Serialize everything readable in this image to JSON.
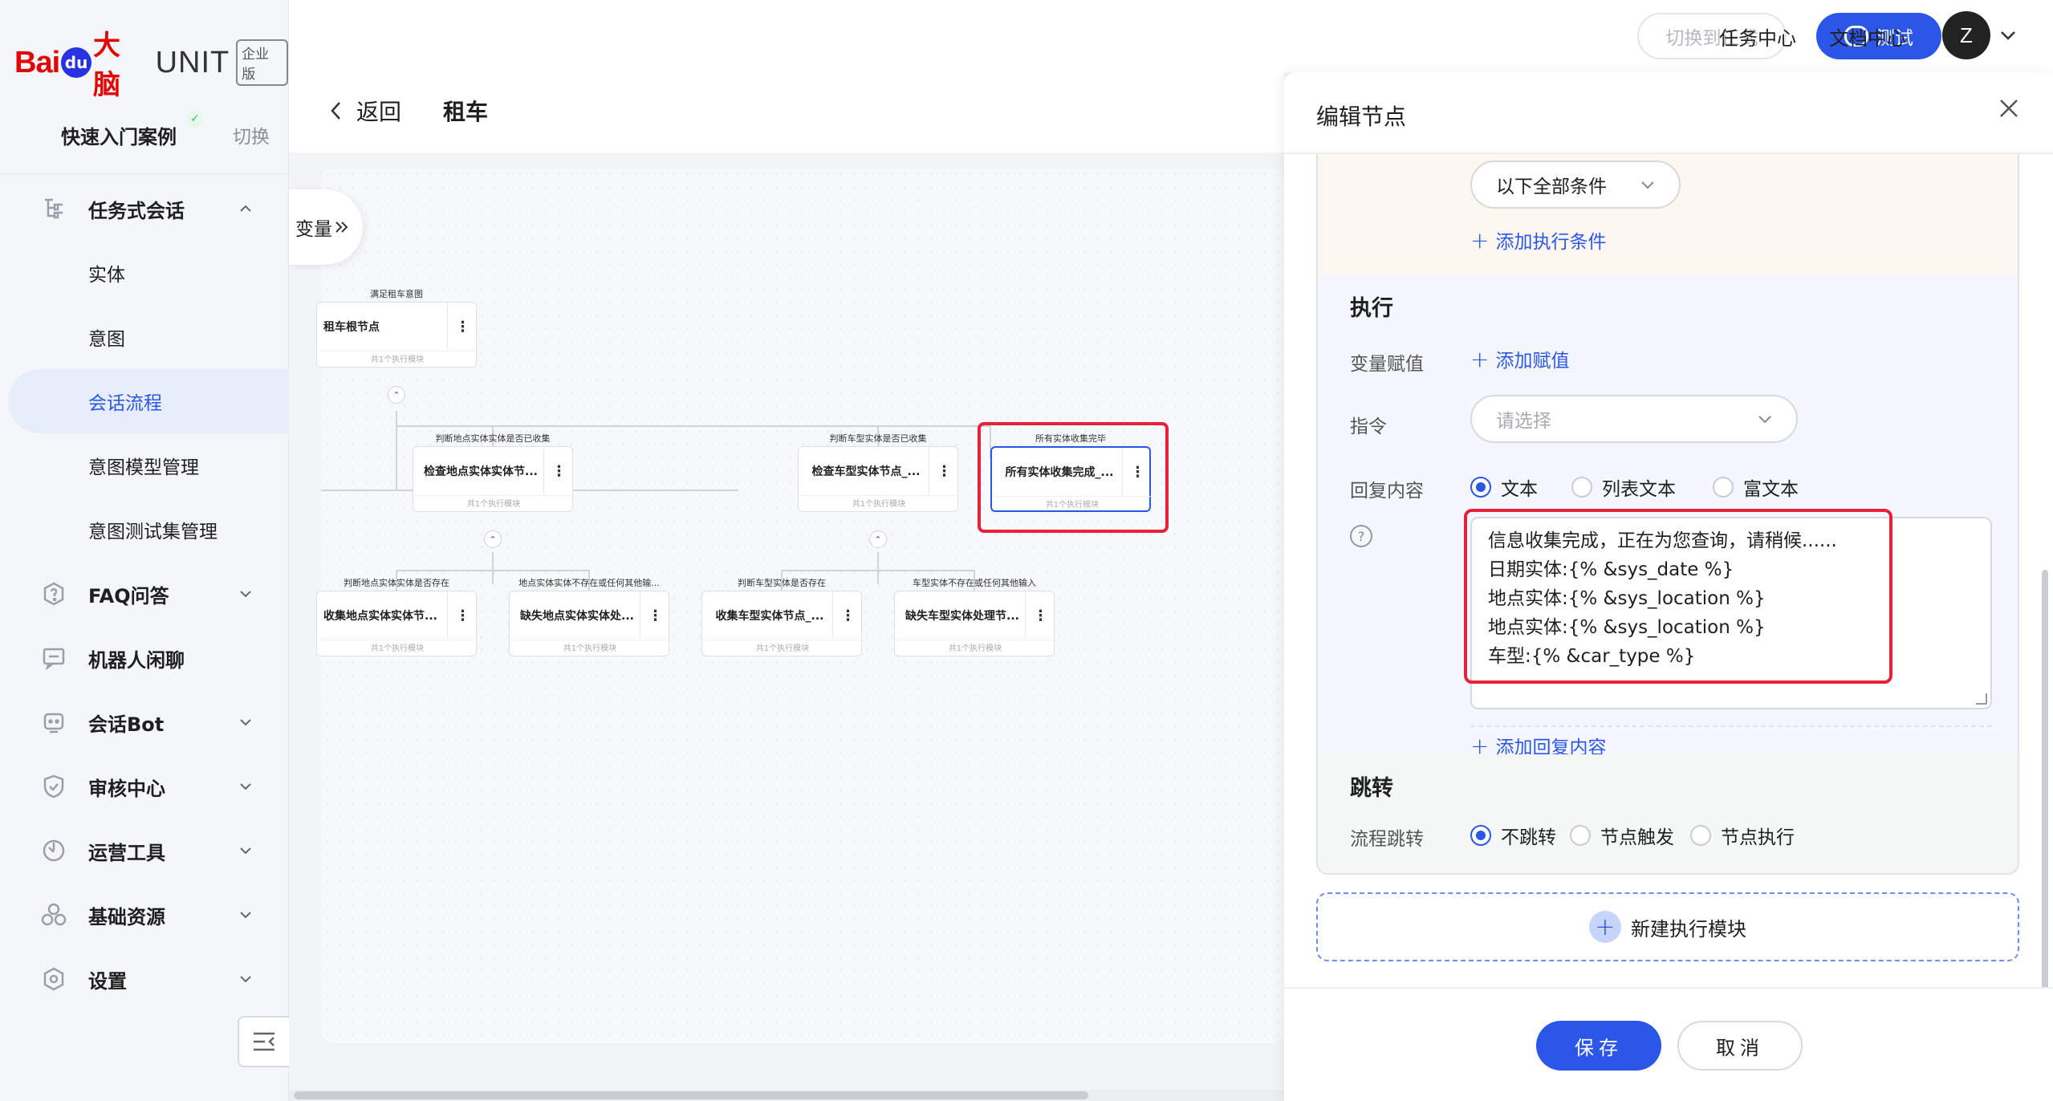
{
  "brand": {
    "bai": "Bai",
    "du": "du",
    "danao": "大脑",
    "unit": "UNIT",
    "edition": "企业版"
  },
  "case": {
    "title": "快速入门案例",
    "switch": "切换"
  },
  "sidebar": {
    "groups": [
      {
        "label": "任务式会话",
        "icon": "tree-icon",
        "expanded": true,
        "items": [
          {
            "label": "实体"
          },
          {
            "label": "意图"
          },
          {
            "label": "会话流程",
            "active": true
          },
          {
            "label": "意图模型管理"
          },
          {
            "label": "意图测试集管理"
          }
        ]
      },
      {
        "label": "FAQ问答",
        "icon": "question-icon"
      },
      {
        "label": "机器人闲聊",
        "icon": "chat-icon"
      },
      {
        "label": "会话Bot",
        "icon": "bot-icon"
      },
      {
        "label": "审核中心",
        "icon": "shield-icon"
      },
      {
        "label": "运营工具",
        "icon": "tool-icon"
      },
      {
        "label": "基础资源",
        "icon": "cubes-icon"
      },
      {
        "label": "设置",
        "icon": "gear-icon"
      }
    ]
  },
  "topbar": {
    "switch_official": "切换到正式",
    "test": "测试",
    "task_center": "任务中心",
    "doc_center": "文档中心",
    "avatar_initial": "Z"
  },
  "canvas": {
    "back": "返回",
    "title": "租车",
    "variables": "变量",
    "nodes": [
      {
        "label": "满足租车意图",
        "name": "租车根节点",
        "footer": "共1个执行模块"
      },
      {
        "label": "判断地点实体实体是否已收集",
        "name": "检查地点实体实体节...",
        "footer": "共1个执行模块"
      },
      {
        "label": "判断车型实体是否已收集",
        "name": "检查车型实体节点_...",
        "footer": "共1个执行模块"
      },
      {
        "label": "所有实体收集完毕",
        "name": "所有实体收集完成_...",
        "footer": "共1个执行模块"
      },
      {
        "label": "判断地点实体实体是否存在",
        "name": "收集地点实体实体节...",
        "footer": "共1个执行模块"
      },
      {
        "label": "地点实体实体不存在或任何其他输...",
        "name": "缺失地点实体实体处...",
        "footer": "共1个执行模块"
      },
      {
        "label": "判断车型实体是否存在",
        "name": "收集车型实体节点_...",
        "footer": "共1个执行模块"
      },
      {
        "label": "车型实体不存在或任何其他输入",
        "name": "缺失车型实体处理节...",
        "footer": "共1个执行模块"
      }
    ]
  },
  "panel": {
    "title": "编辑节点",
    "condition": {
      "select": "以下全部条件",
      "add": "添加执行条件"
    },
    "execute": {
      "title": "执行",
      "var_label": "变量赋值",
      "var_add": "添加赋值",
      "cmd_label": "指令",
      "cmd_placeholder": "请选择",
      "reply_label": "回复内容",
      "reply_types": [
        "文本",
        "列表文本",
        "富文本"
      ],
      "reply_selected": "文本",
      "reply_lines": [
        "信息收集完成，正在为您查询，请稍候......",
        "日期实体:{% &sys_date %}",
        "地点实体:{% &sys_location %}",
        "地点实体:{% &sys_location %}",
        "车型:{% &car_type %}"
      ],
      "reply_add": "添加回复内容"
    },
    "jump": {
      "title": "跳转",
      "label": "流程跳转",
      "options": [
        "不跳转",
        "节点触发",
        "节点执行"
      ],
      "selected": "不跳转"
    },
    "new_module": "新建执行模块",
    "save": "保存",
    "cancel": "取消"
  },
  "colors": {
    "primary": "#2c56e8",
    "highlight": "#e8203a",
    "brand_red": "#e10602"
  }
}
